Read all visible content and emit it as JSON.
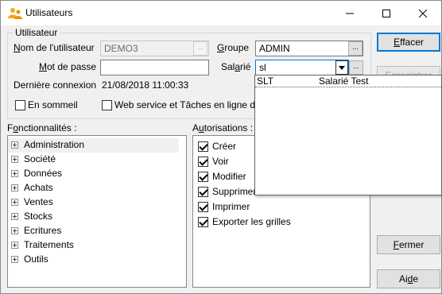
{
  "window": {
    "title": "Utilisateurs",
    "minimize_icon": "minimize-icon",
    "maximize_icon": "maximize-icon",
    "close_icon": "close-icon"
  },
  "user_group": {
    "legend": "Utilisateur",
    "username_label": {
      "pre": "",
      "key": "N",
      "post": "om de l'utilisateur"
    },
    "username_value": "DEMO3",
    "browse": "...",
    "password_label": {
      "pre": "",
      "key": "M",
      "post": "ot de passe"
    },
    "password_value": "",
    "last_login_label": "Dernière connexion",
    "last_login_value": "21/08/2018 11:00:33",
    "group_label": {
      "pre": "",
      "key": "G",
      "post": "roupe"
    },
    "group_value": "ADMIN",
    "employee_label": {
      "pre": "Sal",
      "key": "a",
      "post": "rié"
    },
    "employee_value": "sl",
    "sleep_label": "En sommeil",
    "webservice_label": "Web service et Tâches en ligne de"
  },
  "features": {
    "label": {
      "pre": "F",
      "key": "o",
      "post": "nctionnalités :"
    },
    "items": [
      "Administration",
      "Société",
      "Données",
      "Achats",
      "Ventes",
      "Stocks",
      "Ecritures",
      "Traitements",
      "Outils"
    ]
  },
  "permissions": {
    "label": {
      "pre": "A",
      "key": "u",
      "post": "torisations :"
    },
    "items": [
      {
        "label": "Créer",
        "checked": true
      },
      {
        "label": "Voir",
        "checked": true
      },
      {
        "label": "Modifier",
        "checked": true
      },
      {
        "label": "Supprimer",
        "checked": true
      },
      {
        "label": "Imprimer",
        "checked": true
      },
      {
        "label": "Exporter les grilles",
        "checked": true
      }
    ]
  },
  "employee_dropdown": {
    "rows": [
      {
        "code": "SLT",
        "name": "Salarié Test"
      }
    ]
  },
  "buttons": {
    "clear": {
      "pre": "",
      "key": "E",
      "post": "ffacer"
    },
    "save": "Enregistrer",
    "close": {
      "pre": "",
      "key": "F",
      "post": "ermer"
    },
    "help": {
      "pre": "Ai",
      "key": "d",
      "post": "e"
    }
  },
  "colors": {
    "accent": "#0078d7",
    "app_icon_orange": "#f5a623",
    "tree_selected": "#f0f0f0"
  }
}
